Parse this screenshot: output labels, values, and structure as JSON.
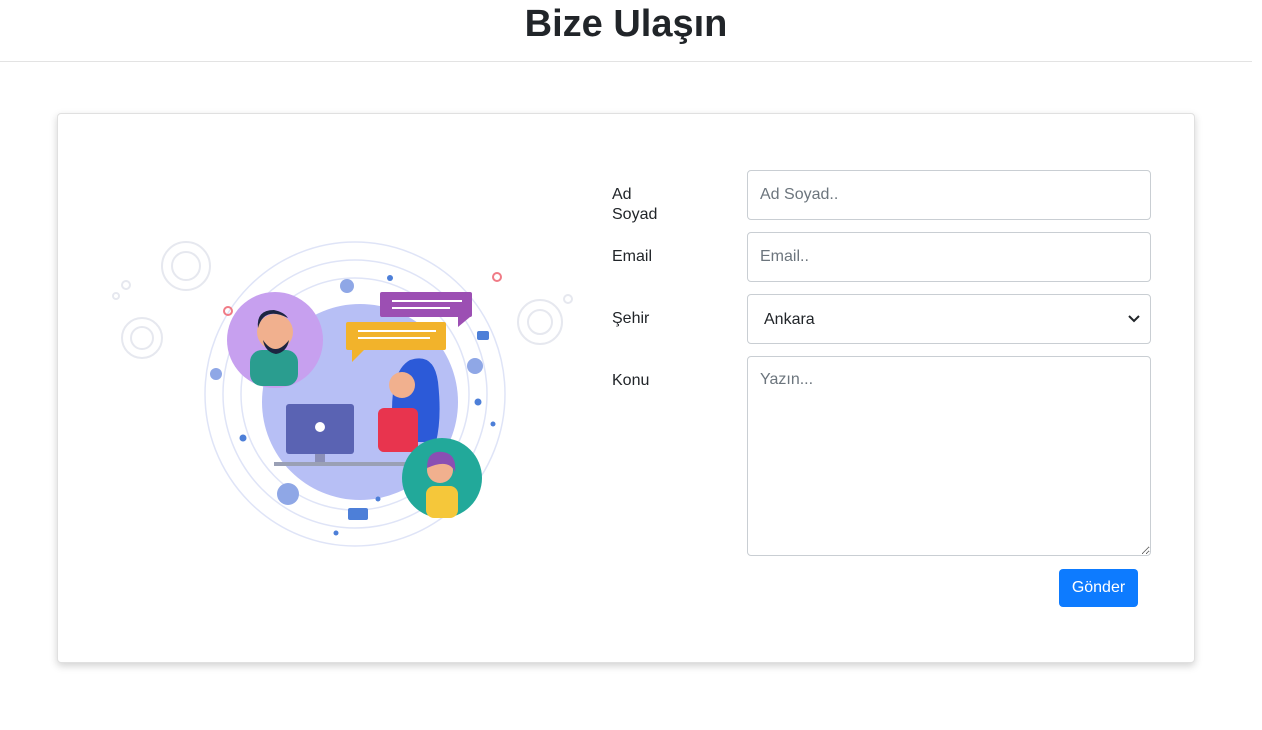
{
  "header": {
    "title": "Bize Ulaşın"
  },
  "form": {
    "name": {
      "label": "Ad Soyad",
      "placeholder": "Ad Soyad.."
    },
    "email": {
      "label": "Email",
      "placeholder": "Email.."
    },
    "city": {
      "label": "Şehir",
      "selected": "Ankara",
      "options": [
        "Ankara"
      ]
    },
    "subject": {
      "label": "Konu",
      "placeholder": "Yazın..."
    },
    "submit_label": "Gönder"
  },
  "colors": {
    "primary": "#0d7bff",
    "text": "#212529",
    "border": "#c9ced3"
  },
  "icons": [
    "chevron-down-icon",
    "contact-illustration"
  ]
}
